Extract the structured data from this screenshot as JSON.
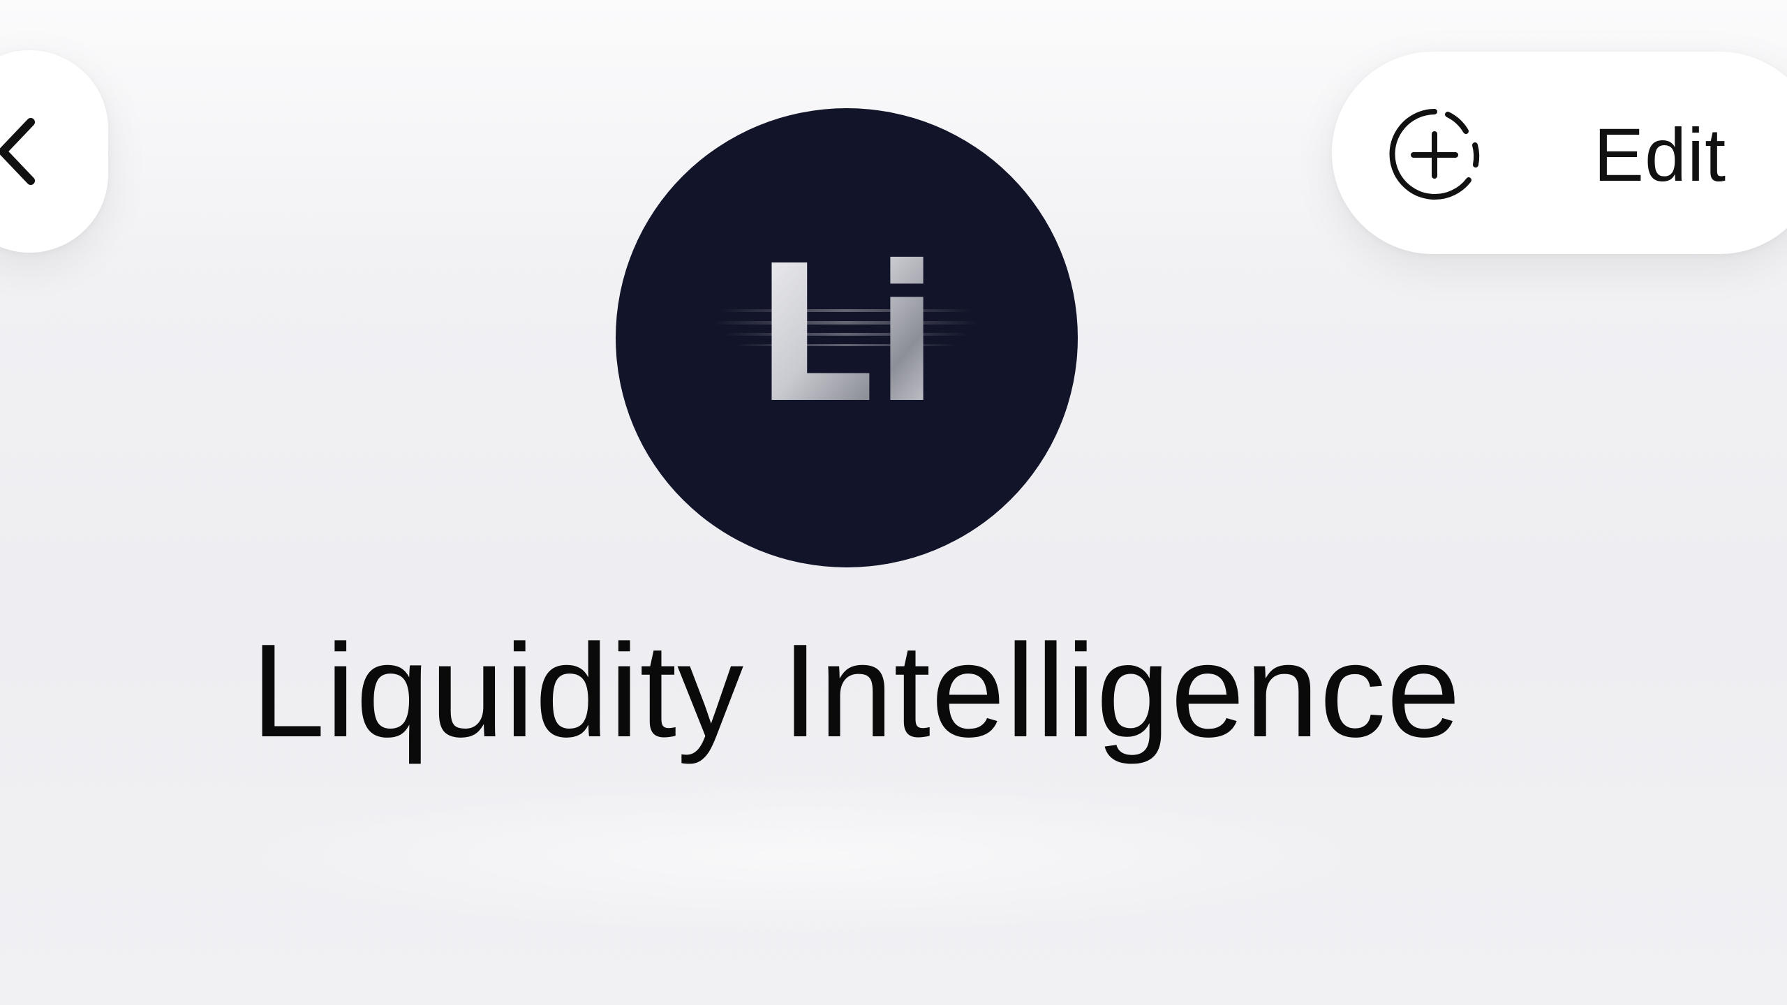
{
  "navigation": {
    "back_icon": "chevron-left-icon"
  },
  "actions": {
    "add_icon": "add-circle-dashed-icon",
    "edit_label": "Edit"
  },
  "profile": {
    "avatar_text": "Li",
    "avatar_background": "#121429",
    "name": "Liquidity Intelligence"
  }
}
